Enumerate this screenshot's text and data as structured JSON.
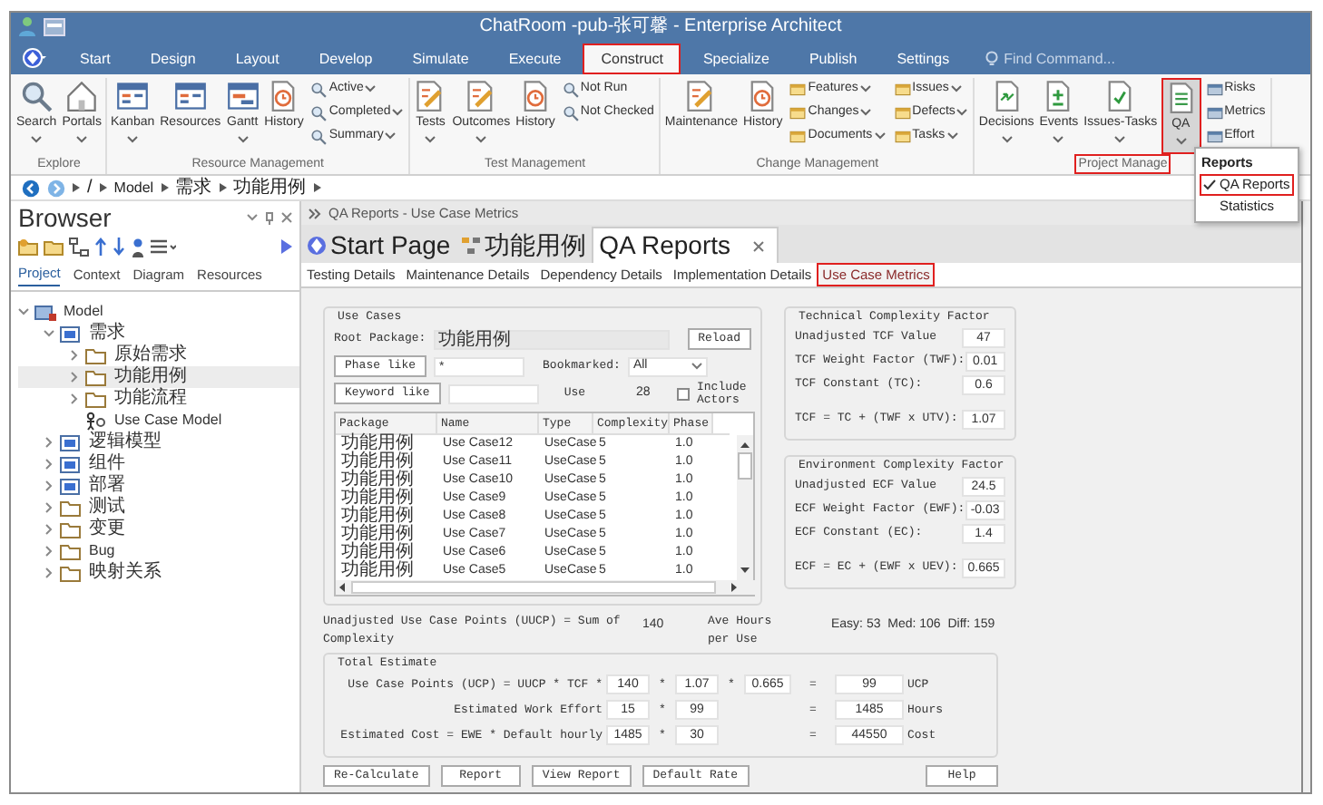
{
  "title_bar": {
    "title": "ChatRoom -pub-张可馨 - Enterprise Architect"
  },
  "menu": {
    "tabs": [
      {
        "label": "Start",
        "selected": false,
        "highlighted": false
      },
      {
        "label": "Design",
        "selected": false,
        "highlighted": false
      },
      {
        "label": "Layout",
        "selected": false,
        "highlighted": false
      },
      {
        "label": "Develop",
        "selected": false,
        "highlighted": false
      },
      {
        "label": "Simulate",
        "selected": false,
        "highlighted": false
      },
      {
        "label": "Execute",
        "selected": false,
        "highlighted": false
      },
      {
        "label": "Construct",
        "selected": true,
        "highlighted": true
      },
      {
        "label": "Specialize",
        "selected": false,
        "highlighted": false
      },
      {
        "label": "Publish",
        "selected": false,
        "highlighted": false
      },
      {
        "label": "Settings",
        "selected": false,
        "highlighted": false
      }
    ],
    "search": {
      "placeholder": "Find Command..."
    }
  },
  "ribbon": {
    "groups": [
      {
        "label": "Explore",
        "highlighted": false,
        "large": [
          {
            "label": "Search",
            "dropdown": true,
            "pressed": false,
            "highlighted": false
          },
          {
            "label": "Portals",
            "dropdown": true,
            "pressed": false,
            "highlighted": false
          }
        ]
      },
      {
        "label": "Resource Management",
        "highlighted": false,
        "large": [
          {
            "label": "Kanban",
            "dropdown": true,
            "pressed": false,
            "highlighted": false
          },
          {
            "label": "Resources",
            "dropdown": false,
            "pressed": false,
            "highlighted": false
          },
          {
            "label": "Gantt",
            "dropdown": true,
            "pressed": false,
            "highlighted": false
          },
          {
            "label": "History",
            "dropdown": false,
            "pressed": false,
            "highlighted": false
          }
        ],
        "small_columns": [
          [
            {
              "label": "Active",
              "dropdown": true
            },
            {
              "label": "Completed",
              "dropdown": true
            },
            {
              "label": "Summary",
              "dropdown": true
            }
          ]
        ]
      },
      {
        "label": "Test Management",
        "highlighted": false,
        "large": [
          {
            "label": "Tests",
            "dropdown": true,
            "pressed": false,
            "highlighted": false
          },
          {
            "label": "Outcomes",
            "dropdown": true,
            "pressed": false,
            "highlighted": false
          },
          {
            "label": "History",
            "dropdown": false,
            "pressed": false,
            "highlighted": false
          }
        ],
        "small_columns": [
          [
            {
              "label": "Not Run",
              "dropdown": false
            },
            {
              "label": "Not Checked",
              "dropdown": false
            }
          ]
        ]
      },
      {
        "label": "Change Management",
        "highlighted": false,
        "large": [
          {
            "label": "Maintenance",
            "dropdown": false,
            "pressed": false,
            "highlighted": false
          },
          {
            "label": "History",
            "dropdown": false,
            "pressed": false,
            "highlighted": false
          }
        ],
        "small_columns": [
          [
            {
              "label": "Features",
              "dropdown": true
            },
            {
              "label": "Changes",
              "dropdown": true
            },
            {
              "label": "Documents",
              "dropdown": true
            }
          ],
          [
            {
              "label": "Issues",
              "dropdown": true
            },
            {
              "label": "Defects",
              "dropdown": true
            },
            {
              "label": "Tasks",
              "dropdown": true
            }
          ]
        ]
      },
      {
        "label": "Project Manage",
        "highlighted": true,
        "large": [
          {
            "label": "Decisions",
            "dropdown": true,
            "pressed": false,
            "highlighted": false
          },
          {
            "label": "Events",
            "dropdown": true,
            "pressed": false,
            "highlighted": false
          },
          {
            "label": "Issues-Tasks",
            "dropdown": true,
            "pressed": false,
            "highlighted": false
          },
          {
            "label": "QA",
            "dropdown": true,
            "pressed": true,
            "highlighted": true
          }
        ],
        "small_columns": [
          [
            {
              "label": "Risks",
              "dropdown": false
            },
            {
              "label": "Metrics",
              "dropdown": false
            },
            {
              "label": "Effort",
              "dropdown": false
            }
          ]
        ]
      }
    ]
  },
  "popup_menu": {
    "heading": "Reports",
    "items": [
      {
        "label": "QA Reports",
        "checked": true,
        "highlighted": true
      },
      {
        "label": "Statistics",
        "checked": false,
        "highlighted": false
      }
    ]
  },
  "breadcrumb": [
    "/",
    "Model",
    "需求",
    "功能用例"
  ],
  "browser": {
    "title": "Browser",
    "tabs": [
      {
        "label": "Project",
        "selected": true
      },
      {
        "label": "Context",
        "selected": false
      },
      {
        "label": "Diagram",
        "selected": false
      },
      {
        "label": "Resources",
        "selected": false
      }
    ],
    "tree": [
      {
        "label": "Model",
        "kind": "model",
        "expanded": true,
        "selected": false,
        "children": [
          {
            "label": "需求",
            "kind": "package",
            "expanded": true,
            "selected": false,
            "children": [
              {
                "label": "原始需求",
                "kind": "folder",
                "expanded": false,
                "selected": false
              },
              {
                "label": "功能用例",
                "kind": "folder",
                "expanded": false,
                "selected": true
              },
              {
                "label": "功能流程",
                "kind": "folder",
                "expanded": false,
                "selected": false
              },
              {
                "label": "Use Case Model",
                "kind": "diagram",
                "selected": false
              }
            ]
          },
          {
            "label": "逻辑模型",
            "kind": "package",
            "expanded": false,
            "selected": false
          },
          {
            "label": "组件",
            "kind": "package",
            "expanded": false,
            "selected": false
          },
          {
            "label": "部署",
            "kind": "package",
            "expanded": false,
            "selected": false
          },
          {
            "label": "测试",
            "kind": "folder",
            "expanded": false,
            "selected": false
          },
          {
            "label": "变更",
            "kind": "folder",
            "expanded": false,
            "selected": false
          },
          {
            "label": "Bug",
            "kind": "folder",
            "expanded": false,
            "selected": false
          },
          {
            "label": "映射关系",
            "kind": "folder",
            "expanded": false,
            "selected": false
          }
        ]
      }
    ]
  },
  "main": {
    "header": "QA Reports - Use Case Metrics",
    "doc_tabs": [
      {
        "label": "Start Page",
        "kind": "start",
        "selected": false,
        "closable": false
      },
      {
        "label": "功能用例",
        "kind": "diagram",
        "selected": false,
        "closable": false
      },
      {
        "label": "QA Reports",
        "kind": "report",
        "selected": true,
        "closable": true
      }
    ],
    "report_tabs": [
      {
        "label": "Testing Details",
        "selected": false,
        "highlighted": false
      },
      {
        "label": "Maintenance Details",
        "selected": false,
        "highlighted": false
      },
      {
        "label": "Dependency Details",
        "selected": false,
        "highlighted": false
      },
      {
        "label": "Implementation Details",
        "selected": false,
        "highlighted": false
      },
      {
        "label": "Use Case Metrics",
        "selected": true,
        "highlighted": true
      }
    ],
    "use_cases": {
      "legend": "Use Cases",
      "root_label": "Root Package:",
      "root_value": "功能用例",
      "reload": "Reload",
      "phase_button": "Phase like",
      "phase_value": "*",
      "bookmarked_label": "Bookmarked:",
      "bookmarked_value": "All",
      "keyword_button": "Keyword like",
      "use_label": "Use",
      "use_count": "28",
      "include_actors": {
        "label": "Include Actors",
        "checked": false
      },
      "table": {
        "columns": [
          "Package",
          "Name",
          "Type",
          "Complexity",
          "Phase"
        ],
        "rows": [
          [
            "功能用例",
            "Use Case12",
            "UseCase",
            "5",
            "1.0"
          ],
          [
            "功能用例",
            "Use Case11",
            "UseCase",
            "5",
            "1.0"
          ],
          [
            "功能用例",
            "Use Case10",
            "UseCase",
            "5",
            "1.0"
          ],
          [
            "功能用例",
            "Use Case9",
            "UseCase",
            "5",
            "1.0"
          ],
          [
            "功能用例",
            "Use Case8",
            "UseCase",
            "5",
            "1.0"
          ],
          [
            "功能用例",
            "Use Case7",
            "UseCase",
            "5",
            "1.0"
          ],
          [
            "功能用例",
            "Use Case6",
            "UseCase",
            "5",
            "1.0"
          ],
          [
            "功能用例",
            "Use Case5",
            "UseCase",
            "5",
            "1.0"
          ]
        ]
      }
    },
    "tcf": {
      "legend": "Technical Complexity Factor",
      "rows": [
        {
          "label": "Unadjusted TCF Value",
          "value": "47"
        },
        {
          "label": "TCF Weight Factor (TWF):",
          "value": "0.01"
        },
        {
          "label": "TCF Constant (TC):",
          "value": "0.6"
        },
        {
          "label": "TCF = TC + (TWF x UTV):",
          "value": "1.07"
        }
      ]
    },
    "ecf": {
      "legend": "Environment Complexity Factor",
      "rows": [
        {
          "label": "Unadjusted ECF Value",
          "value": "24.5"
        },
        {
          "label": "ECF Weight Factor (EWF):",
          "value": "-0.03"
        },
        {
          "label": "ECF Constant (EC):",
          "value": "1.4"
        },
        {
          "label": "ECF  = EC + (EWF x UEV):",
          "value": "0.665"
        }
      ]
    },
    "uucp": {
      "label": "Unadjusted Use Case Points (UUCP) = Sum of Complexity",
      "value": "140",
      "ave_label": "Ave Hours per Use",
      "breakdown": "Easy: 53  Med: 106  Diff: 159"
    },
    "total": {
      "legend": "Total Estimate",
      "rows": [
        {
          "label": "Use Case Points (UCP) = UUCP * TCF *",
          "terms": [
            "140",
            "*",
            "1.07",
            "*",
            "0.665"
          ],
          "eq": "=",
          "result": "99",
          "unit": "UCP"
        },
        {
          "label": "Estimated Work Effort",
          "terms": [
            "15",
            "*",
            "99"
          ],
          "eq": "=",
          "result": "1485",
          "unit": "Hours"
        },
        {
          "label": "Estimated Cost  = EWE * Default hourly",
          "terms": [
            "1485",
            "*",
            "30"
          ],
          "eq": "=",
          "result": "44550",
          "unit": "Cost"
        }
      ]
    },
    "buttons": [
      "Re-Calculate",
      "Report",
      "View Report",
      "Default Rate"
    ],
    "help": "Help"
  }
}
